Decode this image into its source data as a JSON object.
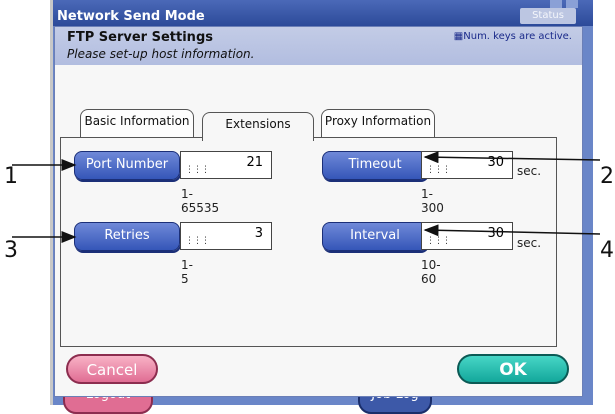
{
  "window": {
    "title": "Network Send Mode",
    "status_label": "Status",
    "bottom_buttons": {
      "logout": "Logout",
      "job_log": "Job Log"
    }
  },
  "dialog": {
    "title": "FTP Server Settings",
    "subtitle": "Please set-up host information.",
    "num_keys_notice": "Num. keys are active."
  },
  "tabs": [
    {
      "label": "Basic Information",
      "active": false
    },
    {
      "label": "Extensions",
      "active": true
    },
    {
      "label": "Proxy Information",
      "active": false
    }
  ],
  "fields": {
    "port_number": {
      "label": "Port Number",
      "value": "21",
      "range": "1-65535"
    },
    "timeout": {
      "label": "Timeout",
      "value": "30",
      "range": "1-300",
      "unit": "sec."
    },
    "retries": {
      "label": "Retries",
      "value": "3",
      "range": "1-5"
    },
    "interval": {
      "label": "Interval",
      "value": "30",
      "range": "10-60",
      "unit": "sec."
    }
  },
  "actions": {
    "cancel": "Cancel",
    "ok": "OK"
  },
  "callouts": {
    "one": "1",
    "two": "2",
    "three": "3",
    "four": "4"
  },
  "colors": {
    "accent_blue": "#3556b8",
    "ok_teal": "#13a79b",
    "cancel_pink": "#e06d93"
  }
}
